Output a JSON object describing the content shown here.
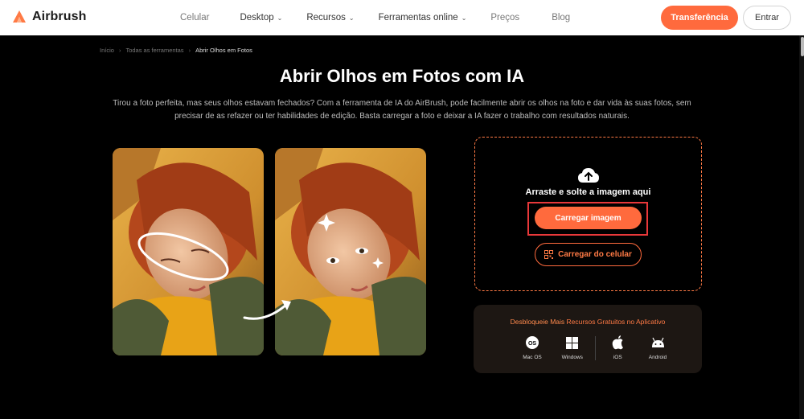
{
  "header": {
    "logo_text": "Airbrush",
    "nav": [
      {
        "label": "Celular",
        "dropdown": false
      },
      {
        "label": "Desktop",
        "dropdown": true
      },
      {
        "label": "Recursos",
        "dropdown": true
      },
      {
        "label": "Ferramentas online",
        "dropdown": true
      },
      {
        "label": "Preços",
        "dropdown": false
      },
      {
        "label": "Blog",
        "dropdown": false
      }
    ],
    "transfer_label": "Transferência",
    "login_label": "Entrar"
  },
  "breadcrumb": {
    "home": "Início",
    "all_tools": "Todas as ferramentas",
    "current": "Abrir Olhos em Fotos"
  },
  "page": {
    "title": "Abrir Olhos em Fotos com IA",
    "description": "Tirou a foto perfeita, mas seus olhos estavam fechados? Com a ferramenta de IA do AirBrush, pode facilmente abrir os olhos na foto e dar vida às suas fotos, sem precisar de as refazer ou ter habilidades de edição. Basta carregar a foto e deixar a IA fazer o trabalho com resultados naturais."
  },
  "upload": {
    "drop_text": "Arraste e solte a imagem aqui",
    "upload_button": "Carregar imagem",
    "phone_button": "Carregar do celular"
  },
  "app_promo": {
    "title_prefix": "Desbloqueie Mais ",
    "title_highlight": "Recursos Gratuitos no Aplicativo",
    "platforms": [
      {
        "label": "Mac OS",
        "icon": "macos-icon"
      },
      {
        "label": "Windows",
        "icon": "windows-icon"
      },
      {
        "label": "iOS",
        "icon": "apple-icon"
      },
      {
        "label": "Android",
        "icon": "android-icon"
      }
    ]
  },
  "colors": {
    "accent": "#ff6a3d",
    "highlight_border": "#e8383a",
    "background": "#000000"
  }
}
